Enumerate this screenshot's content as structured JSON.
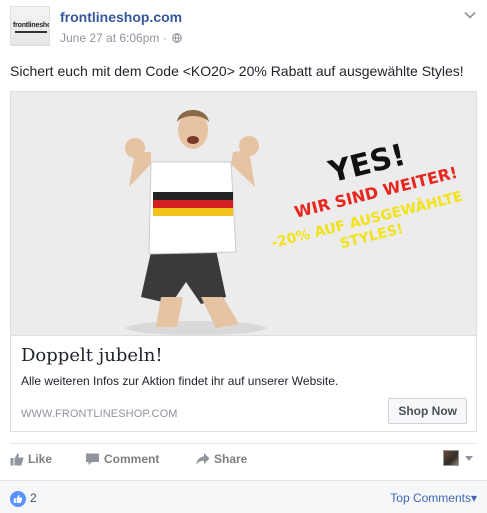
{
  "post": {
    "page_name": "frontlineshop.com",
    "avatar_text": "frontlineshop",
    "timestamp": "June 27 at 6:06pm",
    "separator": "·",
    "privacy_icon": "globe-icon",
    "menu_icon": "chevron-down-icon",
    "text": "Sichert euch mit dem Code <KO20> 20% Rabatt auf ausgewählte Styles!"
  },
  "image": {
    "headline": "YES!",
    "line2": "WIR SIND WEITER!",
    "line3": "-20% AUF AUSGEWÄHLTE",
    "line4": "STYLES!",
    "headline_color": "#111111",
    "line2_color": "#e8261f",
    "line3_color": "#f2e21a"
  },
  "card": {
    "title": "Doppelt jubeln!",
    "description": "Alle weiteren Infos zur Aktion findet ihr auf unserer Website.",
    "domain": "WWW.FRONTLINESHOP.COM",
    "button_label": "Shop Now"
  },
  "actions": {
    "like": "Like",
    "comment": "Comment",
    "share": "Share",
    "like_icon": "thumbs-up-icon",
    "comment_icon": "comment-icon",
    "share_icon": "share-arrow-icon"
  },
  "footer": {
    "like_count": "2",
    "sort_label": "Top Comments",
    "sort_caret": "▾"
  },
  "colors": {
    "link_blue": "#365899",
    "accent_blue": "#4267b2",
    "like_badge": "#5890ff",
    "muted": "#90949c"
  }
}
